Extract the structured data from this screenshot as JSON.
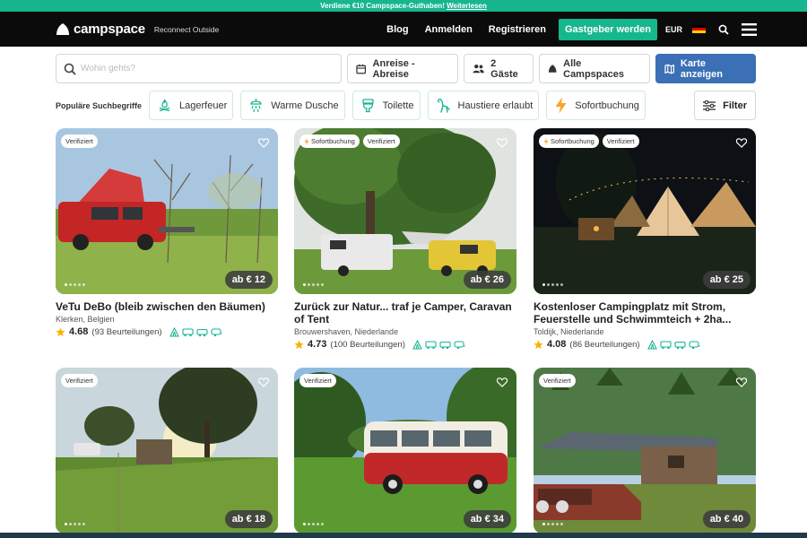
{
  "promo": {
    "text": "Verdiene €10 Campspace-Guthaben!",
    "link": "Weiterlesen"
  },
  "nav": {
    "brand": "campspace",
    "tagline": "Reconnect Outside",
    "links": [
      "Blog",
      "Anmelden",
      "Registrieren"
    ],
    "host_button": "Gastgeber werden",
    "currency": "EUR",
    "flag_colors": [
      "#000000",
      "#dd0000",
      "#ffce00"
    ],
    "icons": [
      "search-icon",
      "menu-icon"
    ]
  },
  "search": {
    "placeholder": "Wohin gehts?",
    "dates": "Anreise - Abreise",
    "guests": "2 Gäste",
    "type": "Alle Campspaces",
    "map_button": "Karte anzeigen"
  },
  "popular": {
    "label": "Populäre Suchbegriffe",
    "chips": [
      "Lagerfeuer",
      "Warme Dusche",
      "Toilette",
      "Haustiere erlaubt",
      "Sofortbuchung"
    ],
    "filter": "Filter"
  },
  "accent_color": "#16b68f",
  "listings": [
    {
      "badges": [
        "Verifiziert"
      ],
      "price": "ab € 12",
      "title": "VeTu DeBo (bleib zwischen den Bäumen)",
      "location": "Klerken, Belgien",
      "rating": "4.68",
      "reviews": "(93 Beurteilungen)"
    },
    {
      "badges": [
        "Sofortbuchung",
        "Verifiziert"
      ],
      "price": "ab € 26",
      "title": "Zurück zur Natur... traf je Camper, Caravan of Tent",
      "location": "Brouwershaven, Niederlande",
      "rating": "4.73",
      "reviews": "(100 Beurteilungen)"
    },
    {
      "badges": [
        "Sofortbuchung",
        "Verifiziert"
      ],
      "price": "ab € 25",
      "title": "Kostenloser Campingplatz mit Strom, Feuerstelle und Schwimmteich + 2ha...",
      "location": "Toldijk, Niederlande",
      "rating": "4.08",
      "reviews": "(86 Beurteilungen)"
    },
    {
      "badges": [
        "Verifiziert"
      ],
      "price": "ab € 18"
    },
    {
      "badges": [
        "Verifiziert"
      ],
      "price": "ab € 34"
    },
    {
      "badges": [
        "Verifiziert"
      ],
      "price": "ab € 40"
    }
  ]
}
